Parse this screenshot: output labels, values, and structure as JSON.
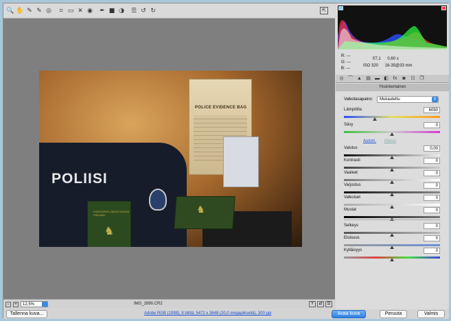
{
  "toolbar": {
    "tools": [
      {
        "icon": "zoom-icon",
        "glyph": "🔍"
      },
      {
        "icon": "hand-icon",
        "glyph": "✋"
      },
      {
        "icon": "white-balance-icon",
        "glyph": "✎"
      },
      {
        "icon": "color-sampler-icon",
        "glyph": "✎"
      },
      {
        "icon": "target-adjust-icon",
        "glyph": "◎"
      },
      {
        "icon": "crop-icon",
        "glyph": "⌗"
      },
      {
        "icon": "straighten-icon",
        "glyph": "▭"
      },
      {
        "icon": "spot-removal-icon",
        "glyph": "✕"
      },
      {
        "icon": "red-eye-icon",
        "glyph": "◉"
      },
      {
        "icon": "adjustment-brush-icon",
        "glyph": "✒"
      },
      {
        "icon": "graduated-filter-icon",
        "glyph": "■"
      },
      {
        "icon": "radial-filter-icon",
        "glyph": "◑"
      },
      {
        "icon": "preferences-icon",
        "glyph": "☰"
      },
      {
        "icon": "rotate-ccw-icon",
        "glyph": "↺"
      },
      {
        "icon": "rotate-cw-icon",
        "glyph": "↻"
      }
    ],
    "fullscreen_glyph": "⇱"
  },
  "photo": {
    "bag_title": "POLICE EVIDENCE BAG",
    "jacket_text": "POLIISI",
    "passport_text": "EUROOPAN UNIONI SUOMI FINLAND"
  },
  "status": {
    "zoom": "12,5%",
    "filename": "IMG_2890.CR2",
    "minus": "−",
    "plus": "+"
  },
  "footer": {
    "save_label": "Tallenna kuva...",
    "workflow_link": "Adobe RGB (1998); 8 bittiä; 5472 x 3648 (20,0 megapikseliä); 300 ppi",
    "open_label": "Avaa kuva",
    "cancel_label": "Peruuta",
    "done_label": "Valmis"
  },
  "info": {
    "r": "R:  ---",
    "g": "G:  ---",
    "b": "B:  ---",
    "aperture": "f/7,1",
    "shutter": "0,60 s",
    "iso": "ISO 320",
    "lens": "16-35@33 mm"
  },
  "panel": {
    "title": "Yksinkertainen",
    "wb_label": "Valkotasapaino:",
    "wb_value": "Mukautettu",
    "auto_label": "Autom.",
    "default_label": "Oletus",
    "sliders_top": [
      {
        "label": "Lämpötila",
        "value": "6050",
        "pos": 0.32
      },
      {
        "label": "Sävy",
        "value": "0",
        "pos": 0.5
      }
    ],
    "sliders_tone": [
      {
        "label": "Valotus",
        "value": "0,00",
        "pos": 0.5
      },
      {
        "label": "Kontrasti",
        "value": "0",
        "pos": 0.5
      },
      {
        "label": "Vaaleat",
        "value": "0",
        "pos": 0.5
      },
      {
        "label": "Varjostus",
        "value": "0",
        "pos": 0.5
      },
      {
        "label": "Valkoiset",
        "value": "0",
        "pos": 0.5
      },
      {
        "label": "Mustat",
        "value": "0",
        "pos": 0.5
      }
    ],
    "sliders_presence": [
      {
        "label": "Selkeys",
        "value": "0",
        "pos": 0.5
      },
      {
        "label": "Eloisuus",
        "value": "0",
        "pos": 0.5
      },
      {
        "label": "Kylläisyys",
        "value": "0",
        "pos": 0.5
      }
    ]
  },
  "colors": {
    "accent": "#2d7fe0",
    "link": "#1d4fd0"
  }
}
